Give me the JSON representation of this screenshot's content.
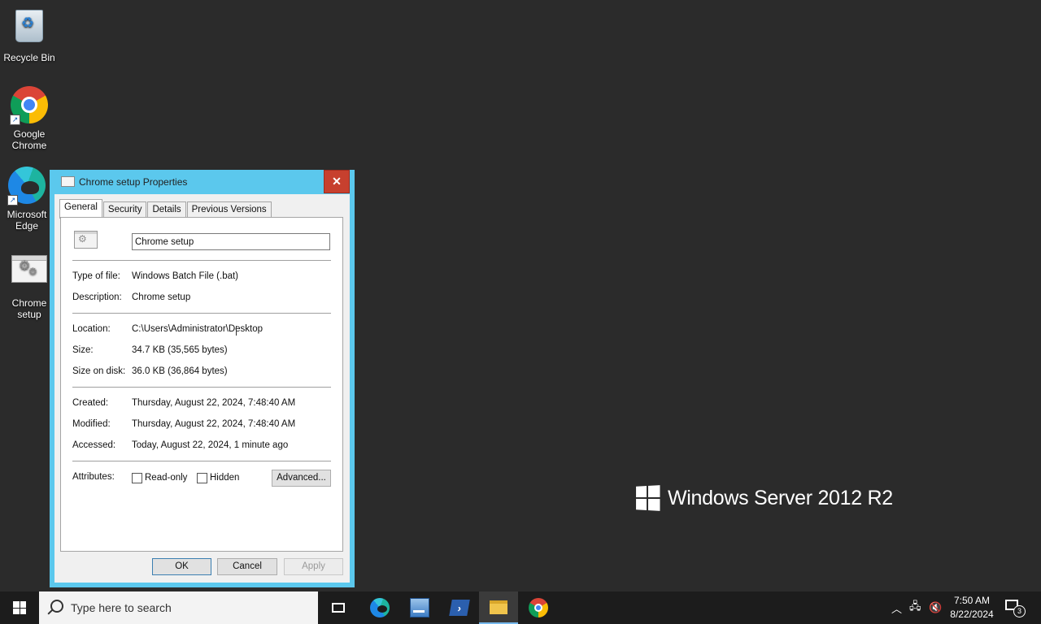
{
  "desktop": {
    "icons": [
      {
        "label": "Recycle Bin",
        "icon": "recycle-bin-icon"
      },
      {
        "label": "Google Chrome",
        "icon": "chrome-icon"
      },
      {
        "label": "Microsoft Edge",
        "icon": "edge-icon"
      },
      {
        "label": "Chrome setup",
        "icon": "batch-file-icon"
      }
    ],
    "watermark": "Windows Server 2012 R2"
  },
  "dialog": {
    "title": "Chrome setup Properties",
    "close_label": "✕",
    "tabs": [
      "General",
      "Security",
      "Details",
      "Previous Versions"
    ],
    "active_tab": "General",
    "file_name": "Chrome setup",
    "rows": {
      "type_label": "Type of file:",
      "type_value": "Windows Batch File (.bat)",
      "desc_label": "Description:",
      "desc_value": "Chrome setup",
      "location_label": "Location:",
      "location_value": "C:\\Users\\Administrator\\Desktop",
      "size_label": "Size:",
      "size_value": "34.7 KB (35,565 bytes)",
      "disk_label": "Size on disk:",
      "disk_value": "36.0 KB (36,864 bytes)",
      "created_label": "Created:",
      "created_value": "Thursday, August 22, 2024, 7:48:40 AM",
      "modified_label": "Modified:",
      "modified_value": "Thursday, August 22, 2024, 7:48:40 AM",
      "accessed_label": "Accessed:",
      "accessed_value": "Today, August 22, 2024, 1 minute ago",
      "attributes_label": "Attributes:"
    },
    "attributes": {
      "readonly_label": "Read-only",
      "hidden_label": "Hidden",
      "advanced_label": "Advanced..."
    },
    "buttons": {
      "ok": "OK",
      "cancel": "Cancel",
      "apply": "Apply"
    }
  },
  "taskbar": {
    "search_placeholder": "Type here to search",
    "clock_time": "7:50 AM",
    "clock_date": "8/22/2024",
    "notification_count": "3"
  },
  "colors": {
    "titlebar": "#5bc8ed",
    "close": "#c7402e",
    "desktop": "#2b2b2b",
    "taskbar": "#1c1c1c"
  }
}
